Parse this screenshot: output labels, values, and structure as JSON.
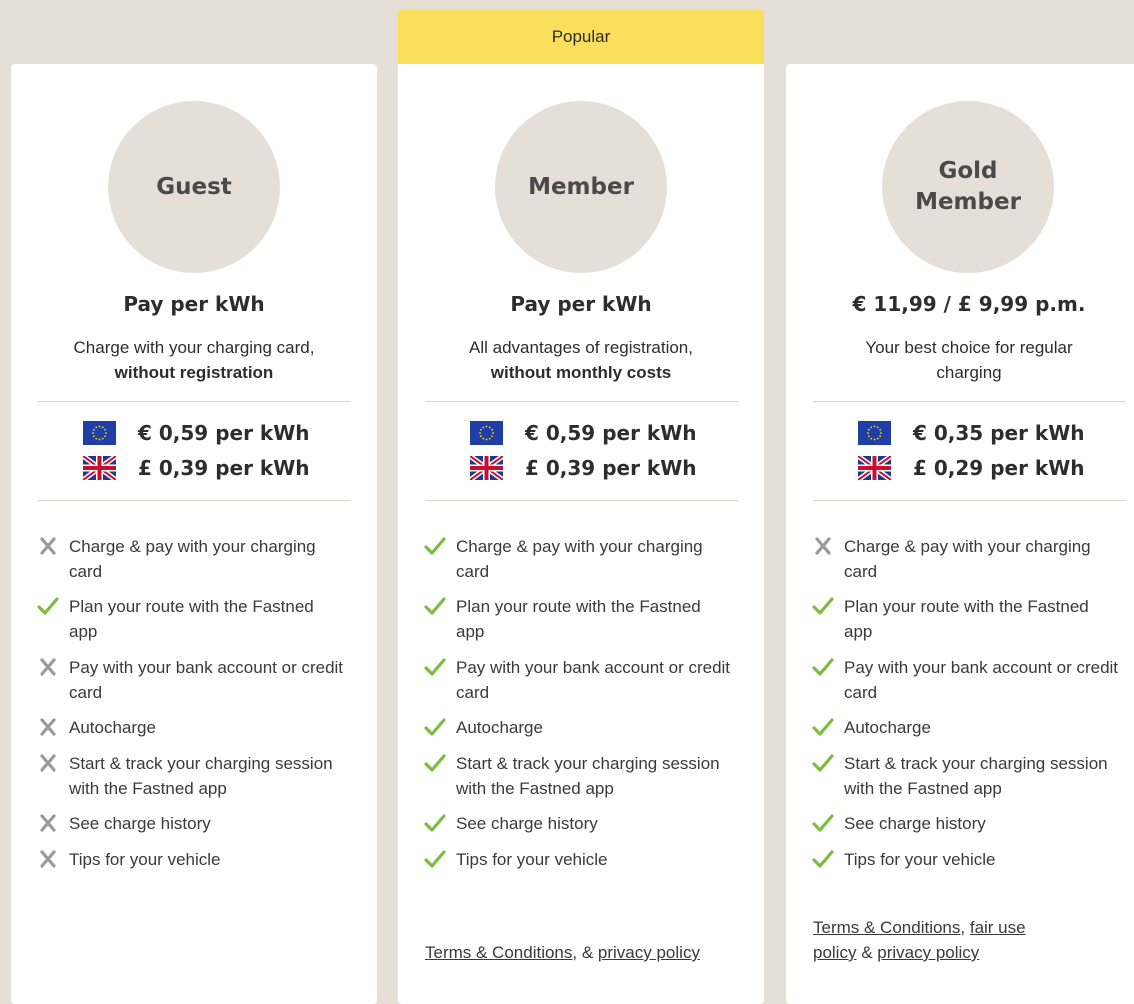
{
  "popular_label": "Popular",
  "colors": {
    "background": "#e5dfd8",
    "card": "#ffffff",
    "popular_banner": "#fadf5c",
    "check": "#7dbb42",
    "cross": "#9a9a9a",
    "circle": "#e5dfd8"
  },
  "cards": [
    {
      "name": "Guest",
      "price_title": "Pay per kWh",
      "subtitle_line1": "Charge with your charging card,",
      "subtitle_bold": "without registration",
      "rates": [
        {
          "flag": "eu-flag-icon",
          "text": "€ 0,59 per kWh"
        },
        {
          "flag": "uk-flag-icon",
          "text": "£ 0,39 per kWh"
        }
      ],
      "features": [
        {
          "icon": "cross-icon",
          "text": "Charge & pay with your charging card"
        },
        {
          "icon": "check-icon",
          "text": "Plan your route with the Fastned app"
        },
        {
          "icon": "cross-icon",
          "text": "Pay with your bank account or credit card"
        },
        {
          "icon": "cross-icon",
          "text": "Autocharge"
        },
        {
          "icon": "cross-icon",
          "text": "Start & track your charging session with the Fastned app"
        },
        {
          "icon": "cross-icon",
          "text": "See charge history"
        },
        {
          "icon": "cross-icon",
          "text": "Tips for your vehicle"
        }
      ]
    },
    {
      "name": "Member",
      "price_title": "Pay per kWh",
      "subtitle_line1": "All advantages of registration,",
      "subtitle_bold": "without monthly costs",
      "rates": [
        {
          "flag": "eu-flag-icon",
          "text": "€ 0,59 per kWh"
        },
        {
          "flag": "uk-flag-icon",
          "text": "£ 0,39 per kWh"
        }
      ],
      "features": [
        {
          "icon": "check-icon",
          "text": "Charge & pay with your charging card"
        },
        {
          "icon": "check-icon",
          "text": "Plan your route with the Fastned app"
        },
        {
          "icon": "check-icon",
          "text": "Pay with your bank account or credit card"
        },
        {
          "icon": "check-icon",
          "text": "Autocharge"
        },
        {
          "icon": "check-icon",
          "text": "Start & track your charging session with the Fastned app"
        },
        {
          "icon": "check-icon",
          "text": "See charge history"
        },
        {
          "icon": "check-icon",
          "text": "Tips for your vehicle"
        }
      ],
      "terms": {
        "link1": "Terms & Conditions",
        "sep1": ", & ",
        "link2": "privacy policy"
      }
    },
    {
      "name": "Gold\nMember",
      "price_title": "€ 11,99 / £ 9,99 p.m.",
      "subtitle_line1": "Your best choice for regular",
      "subtitle_line2": "charging",
      "rates": [
        {
          "flag": "eu-flag-icon",
          "text": "€ 0,35 per kWh"
        },
        {
          "flag": "uk-flag-icon",
          "text": "£ 0,29 per kWh"
        }
      ],
      "features": [
        {
          "icon": "cross-icon",
          "text": "Charge & pay with your charging card"
        },
        {
          "icon": "check-icon",
          "text": "Plan your route with the Fastned app"
        },
        {
          "icon": "check-icon",
          "text": "Pay with your bank account or credit card"
        },
        {
          "icon": "check-icon",
          "text": "Autocharge"
        },
        {
          "icon": "check-icon",
          "text": "Start & track your charging session with the Fastned app"
        },
        {
          "icon": "check-icon",
          "text": "See charge history"
        },
        {
          "icon": "check-icon",
          "text": "Tips for your vehicle"
        }
      ],
      "terms": {
        "link1": "Terms & Conditions",
        "sep1": ", ",
        "link2": "fair use policy",
        "sep2": " & ",
        "link3": "privacy policy"
      }
    }
  ]
}
